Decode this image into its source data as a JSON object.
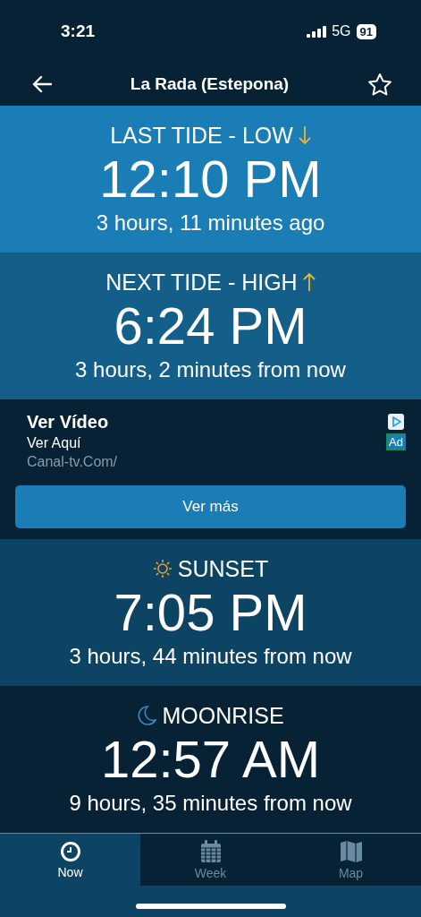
{
  "status_bar": {
    "time": "3:21",
    "network": "5G",
    "battery": "91"
  },
  "nav": {
    "title": "La Rada (Estepona)"
  },
  "events": [
    {
      "label": "LAST TIDE - LOW",
      "kind": "arrow-down",
      "time": "12:10 PM",
      "relative": "3 hours, 11 minutes ago",
      "color": "#1a7db5"
    },
    {
      "label": "NEXT TIDE - HIGH",
      "kind": "arrow-up",
      "time": "6:24 PM",
      "relative": "3 hours, 2 minutes from now",
      "color": "#135f8a"
    },
    {
      "label": "SUNSET",
      "kind": "sun",
      "time": "7:05 PM",
      "relative": "3 hours, 44 minutes from now",
      "color": "#0e4463"
    },
    {
      "label": "MOONRISE",
      "kind": "moon",
      "time": "12:57 AM",
      "relative": "9 hours, 35 minutes from now",
      "color": "#082235"
    }
  ],
  "ad": {
    "title": "Ver Vídeo",
    "subtitle": "Ver Aquí",
    "url": "Canal-tv.Com/",
    "badge": "Ad",
    "button": "Ver más"
  },
  "tabs": [
    {
      "label": "Now",
      "kind": "clock",
      "selected": true
    },
    {
      "label": "Week",
      "kind": "calendar",
      "selected": false
    },
    {
      "label": "Map",
      "kind": "map",
      "selected": false
    }
  ]
}
